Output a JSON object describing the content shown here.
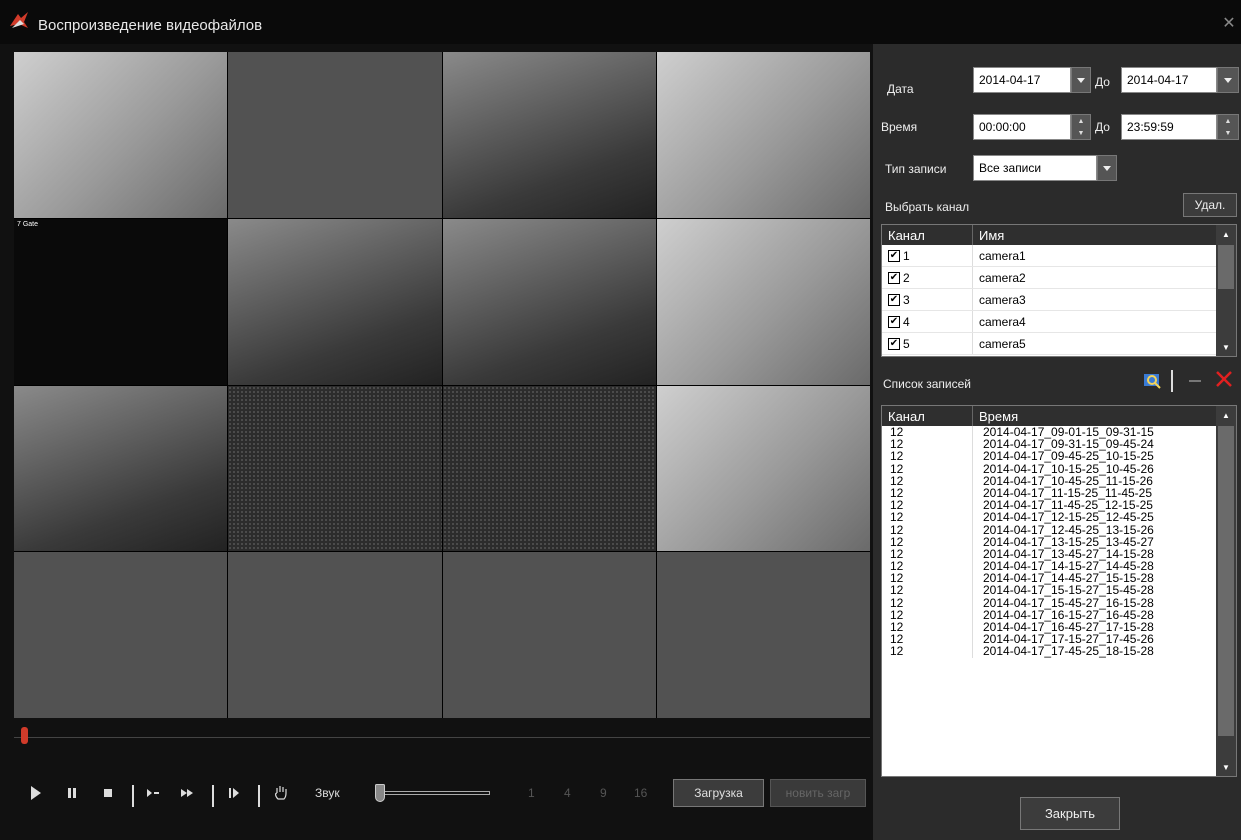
{
  "window": {
    "title": "Воспроизведение видеофайлов"
  },
  "cells": [
    {
      "osd": "",
      "osd_r": ""
    },
    {
      "osd": "",
      "osd_r": ""
    },
    {
      "osd": "",
      "osd_r": ""
    },
    {
      "osd": "",
      "osd_r": ""
    },
    {
      "osd": "7 Gate",
      "osd_r": ""
    },
    {
      "osd": "",
      "osd_r": ""
    },
    {
      "osd": "",
      "osd_r": ""
    },
    {
      "osd": "",
      "osd_r": ""
    },
    {
      "osd": "",
      "osd_r": ""
    },
    {
      "osd": "",
      "osd_r": ""
    },
    {
      "osd": "",
      "osd_r": ""
    },
    {
      "osd": "",
      "osd_r": ""
    },
    {
      "osd": "",
      "osd_r": ""
    },
    {
      "osd": "",
      "osd_r": ""
    },
    {
      "osd": "",
      "osd_r": ""
    },
    {
      "osd": "",
      "osd_r": ""
    }
  ],
  "timeline": {
    "position_fraction": 0.0
  },
  "controls": {
    "sound_label": "Звук",
    "split_options": [
      "1",
      "4",
      "9",
      "16"
    ],
    "load_label": "Загрузка",
    "stop_load_label": "новить загр",
    "volume_fraction": 0.0
  },
  "filters": {
    "date_label": "Дата",
    "date_from": "2014-04-17",
    "to_label": "До",
    "date_to": "2014-04-17",
    "time_label": "Время",
    "time_from": "00:00:00",
    "time_to": "23:59:59",
    "type_label": "Тип записи",
    "type_value": "Все записи"
  },
  "channels": {
    "title": "Выбрать канал",
    "delete_label": "Удал.",
    "headers": [
      "Канал",
      "Имя"
    ],
    "rows": [
      {
        "num": "1",
        "name": "camera1",
        "checked": "✔"
      },
      {
        "num": "2",
        "name": "camera2",
        "checked": "✔"
      },
      {
        "num": "3",
        "name": "camera3",
        "checked": "✔"
      },
      {
        "num": "4",
        "name": "camera4",
        "checked": "✔"
      },
      {
        "num": "5",
        "name": "camera5",
        "checked": "✔"
      }
    ]
  },
  "records": {
    "title": "Список записей",
    "headers": [
      "Канал",
      "Время"
    ],
    "rows": [
      {
        "ch": "12",
        "time": "2014-04-17_09-01-15_09-31-15"
      },
      {
        "ch": "12",
        "time": "2014-04-17_09-31-15_09-45-24"
      },
      {
        "ch": "12",
        "time": "2014-04-17_09-45-25_10-15-25"
      },
      {
        "ch": "12",
        "time": "2014-04-17_10-15-25_10-45-26"
      },
      {
        "ch": "12",
        "time": "2014-04-17_10-45-25_11-15-26"
      },
      {
        "ch": "12",
        "time": "2014-04-17_11-15-25_11-45-25"
      },
      {
        "ch": "12",
        "time": "2014-04-17_11-45-25_12-15-25"
      },
      {
        "ch": "12",
        "time": "2014-04-17_12-15-25_12-45-25"
      },
      {
        "ch": "12",
        "time": "2014-04-17_12-45-25_13-15-26"
      },
      {
        "ch": "12",
        "time": "2014-04-17_13-15-25_13-45-27"
      },
      {
        "ch": "12",
        "time": "2014-04-17_13-45-27_14-15-28"
      },
      {
        "ch": "12",
        "time": "2014-04-17_14-15-27_14-45-28"
      },
      {
        "ch": "12",
        "time": "2014-04-17_14-45-27_15-15-28"
      },
      {
        "ch": "12",
        "time": "2014-04-17_15-15-27_15-45-28"
      },
      {
        "ch": "12",
        "time": "2014-04-17_15-45-27_16-15-28"
      },
      {
        "ch": "12",
        "time": "2014-04-17_16-15-27_16-45-28"
      },
      {
        "ch": "12",
        "time": "2014-04-17_16-45-27_17-15-28"
      },
      {
        "ch": "12",
        "time": "2014-04-17_17-15-27_17-45-26"
      },
      {
        "ch": "12",
        "time": "2014-04-17_17-45-25_18-15-28"
      }
    ]
  },
  "close_label": "Закрыть",
  "colors": {
    "accent": "#d13b2a",
    "selection": "#e5d620",
    "panel": "#2b2b2b"
  }
}
